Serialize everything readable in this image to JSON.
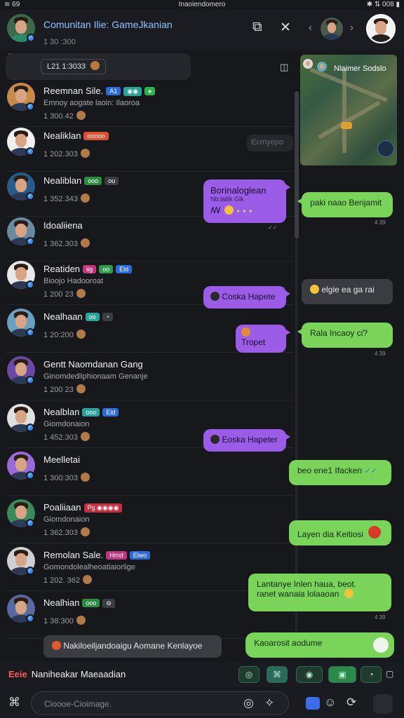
{
  "status": {
    "left": "≋ 69",
    "center": "Inaoiendomero",
    "right": "✱ ⇅ 008 ▮"
  },
  "header": {
    "title": "Comunitan Ilie: GameJkanian",
    "subtitle": "1 30 :300",
    "icons": [
      "split-view-icon",
      "close-icon",
      "chevron-left-icon",
      "chevron-right-icon"
    ]
  },
  "top_pill": {
    "text": "L21 1:3033"
  },
  "rows": [
    {
      "name": "Reemnan Sile.",
      "preview": "Emnoy aogate laoin: Ilaoroa",
      "meta": "1 300.42",
      "badges": [
        [
          "#2e6ad8",
          "A1"
        ],
        [
          "#2aa39a",
          "◉◉"
        ],
        [
          "#2bb54a",
          "●"
        ]
      ]
    },
    {
      "name": "Nealiklan",
      "preview": "",
      "meta": "1 202.303",
      "badges": [
        [
          "#e05030",
          "ooooo"
        ]
      ]
    },
    {
      "name": "Nealiblan",
      "preview": "",
      "meta": "1 352.343",
      "badges": [
        [
          "#2d8a3e",
          "ooo"
        ],
        [
          "#3a3d44",
          "ou"
        ]
      ]
    },
    {
      "name": "Idoaliiena",
      "preview": "",
      "meta": "1 362.303",
      "badges": []
    },
    {
      "name": "Reatiden",
      "preview": "Bioojo Hadooroat",
      "meta": "1 200 23",
      "badges": [
        [
          "#c2367d",
          "iig"
        ],
        [
          "#2f9a4a",
          "oo"
        ],
        [
          "#2e6ad8",
          "Eld"
        ]
      ]
    },
    {
      "name": "Nealhaan",
      "preview": "",
      "meta": "1 20:200",
      "badges": [
        [
          "#2aa39a",
          "oo"
        ],
        [
          "#3a3d44",
          "◔"
        ]
      ]
    },
    {
      "name": "Gentt Naomdanan Gang",
      "preview": "Ginomdedliphionaam Genanje",
      "meta": "1 200 23",
      "badges": []
    },
    {
      "name": "Nealblan",
      "preview": "Giomdonaion",
      "meta": "1 452.303",
      "badges": [
        [
          "#2aa39a",
          "ooo"
        ],
        [
          "#2e6ad8",
          "Eid"
        ]
      ]
    },
    {
      "name": "Meelletai",
      "preview": "",
      "meta": "1 300:303",
      "badges": []
    },
    {
      "name": "Poaliiaan",
      "preview": "Giomdonaion",
      "meta": "1 362.303",
      "badges": [
        [
          "#c23040",
          "Pg ◉◉◉◉"
        ]
      ]
    },
    {
      "name": "Remolan Sale.",
      "preview": "Gomondolealheoatiaiorlige",
      "meta": "1 202. 362",
      "badges": [
        [
          "#c2367d",
          "Hrnd"
        ],
        [
          "#2e6ad8",
          "Elwo"
        ]
      ]
    },
    {
      "name": "Nealhian",
      "preview": "",
      "meta": "1 38:300",
      "badges": [
        [
          "#2d8a3e",
          "ooo"
        ],
        [
          "#3a3d44",
          "⊖"
        ]
      ]
    }
  ],
  "bubbles": {
    "purple1": {
      "line1": "Borinaloglean",
      "line2": "Nb:lalllk Glk"
    },
    "purple2": "Coska Hapete",
    "purple3": "Tropet",
    "purple4": "Eoska Hapeter",
    "grey_top": "Ecmyepo",
    "green1": "paki naao Benjamit",
    "grey_mid": "elgie ea ga rai",
    "green2": "Rala Incaoy ci?",
    "green3": "beo ene1 Ifacken",
    "green4": "Layen dia Keitiosi",
    "green5": {
      "line1": "Lantanye Inlen haua, beot.",
      "line2": "ranet wanaia lolaaoan"
    },
    "green6": "Kaoarosit aodume",
    "bottom_grey": "Nakiloeiljandoaigu Aomane Kenlayoe",
    "ticks": [
      "4 39",
      "4 39",
      "4 39"
    ]
  },
  "video": {
    "label": "Nlaimer Sodslo"
  },
  "actionbar": {
    "tag": "Eeie",
    "title": "Naniheakar Maeaadian"
  },
  "composer": {
    "placeholder": "Cioooe-Cioimage."
  }
}
